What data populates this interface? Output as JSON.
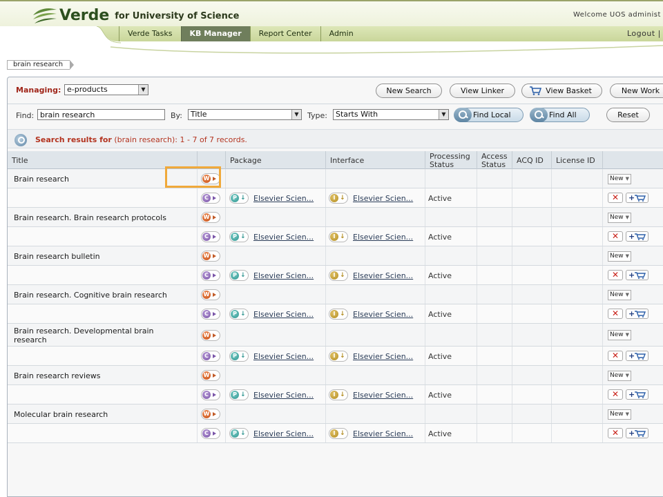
{
  "app": {
    "logo_text": "Verde",
    "logo_sub": "for University of Science",
    "welcome": "Welcome UOS administ",
    "logout": "Logout |"
  },
  "nav": {
    "tabs": [
      {
        "label": "Verde Tasks",
        "active": false
      },
      {
        "label": "KB Manager",
        "active": true
      },
      {
        "label": "Report Center",
        "active": false
      },
      {
        "label": "Admin",
        "active": false
      }
    ]
  },
  "breadcrumb": "brain research",
  "managing": {
    "label": "Managing:",
    "value": "e-products"
  },
  "toolbar": {
    "new_search": "New Search",
    "view_linker": "View Linker",
    "view_basket": "View Basket",
    "new_work": "New Work"
  },
  "find": {
    "find_label": "Find:",
    "find_value": "brain research",
    "by_label": "By:",
    "by_value": "Title",
    "type_label": "Type:",
    "type_value": "Starts With",
    "find_local": "Find Local",
    "find_all": "Find All",
    "reset": "Reset"
  },
  "results": {
    "prefix": "Search results for",
    "query": "(brain research): 1 - 7  of 7 records."
  },
  "columns": {
    "title": "Title",
    "package": "Package",
    "interface": "Interface",
    "processing_status": "Processing Status",
    "access_status": "Access Status",
    "acq_id": "ACQ ID",
    "license_id": "License ID"
  },
  "badges": {
    "work": "W",
    "constituent": "C",
    "package": "P",
    "interface": "I",
    "new": "New",
    "delete": "✕",
    "add_to_basket": "+"
  },
  "records": [
    {
      "title": "Brain research",
      "package": "Elsevier Scien...",
      "interface": "Elsevier Scien...",
      "status": "Active"
    },
    {
      "title": "Brain research. Brain research protocols",
      "package": "Elsevier Scien...",
      "interface": "Elsevier Scien...",
      "status": "Active"
    },
    {
      "title": "Brain research bulletin",
      "package": "Elsevier Scien...",
      "interface": "Elsevier Scien...",
      "status": "Active"
    },
    {
      "title": "Brain research. Cognitive brain research",
      "package": "Elsevier Scien...",
      "interface": "Elsevier Scien...",
      "status": "Active"
    },
    {
      "title": "Brain research. Developmental brain research",
      "package": "Elsevier Scien...",
      "interface": "Elsevier Scien...",
      "status": "Active"
    },
    {
      "title": "Brain research reviews",
      "package": "Elsevier Scien...",
      "interface": "Elsevier Scien...",
      "status": "Active"
    },
    {
      "title": "Molecular brain research",
      "package": "Elsevier Scien...",
      "interface": "Elsevier Scien...",
      "status": "Active"
    }
  ],
  "colors": {
    "accent_red": "#a0261a",
    "nav_active": "#6f7e5c",
    "highlight": "#f0a93a"
  }
}
